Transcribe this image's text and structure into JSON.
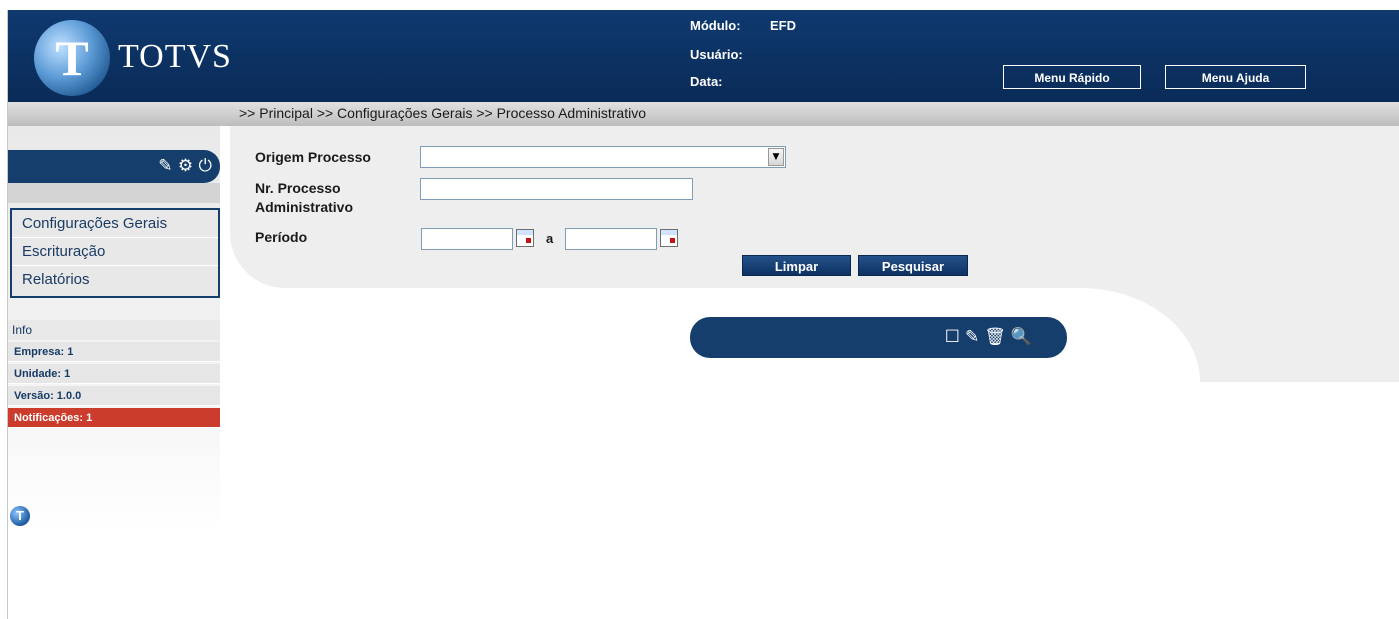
{
  "header": {
    "logo_text": "TOTVS",
    "logo_mark": "T",
    "modulo_label": "Módulo:",
    "modulo_value": "EFD",
    "usuario_label": "Usuário:",
    "data_label": "Data:",
    "menu_rapido": "Menu Rápido",
    "menu_ajuda": "Menu Ajuda"
  },
  "breadcrumb": ">> Principal >> Configurações Gerais >> Processo Administrativo",
  "sidebar": {
    "header_icons": "🖉 ⚙ ⏻",
    "menu": [
      {
        "label": "Configurações Gerais"
      },
      {
        "label": "Escrituração"
      },
      {
        "label": "Relatórios"
      }
    ],
    "info_title": "Info",
    "info": [
      {
        "label": "Empresa: 1"
      },
      {
        "label": "Unidade: 1"
      },
      {
        "label": "Versão: 1.0.0"
      },
      {
        "label": "Notificações: 1"
      }
    ],
    "badge": "T"
  },
  "form": {
    "origem_label": "Origem Processo",
    "origem_value": "",
    "nr_label_1": "Nr. Processo",
    "nr_label_2": "Administrativo",
    "nr_value": "",
    "periodo_label": "Período",
    "periodo_from": "",
    "periodo_sep": "a",
    "periodo_to": "",
    "limpar": "Limpar",
    "pesquisar": "Pesquisar"
  },
  "toolbar": {
    "icons": [
      "new-icon",
      "edit-icon",
      "delete-icon",
      "view-icon"
    ]
  }
}
